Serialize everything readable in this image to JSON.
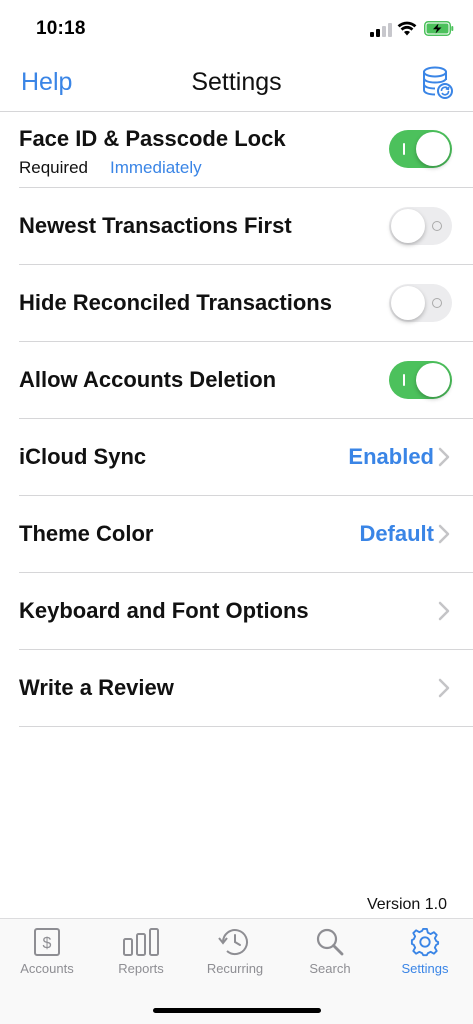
{
  "status_bar": {
    "time": "10:18",
    "icons": [
      "signal-icon",
      "wifi-icon",
      "battery-charging-icon"
    ]
  },
  "nav": {
    "left_button": "Help",
    "title": "Settings",
    "right_icon": "database-sync-icon"
  },
  "colors": {
    "accent": "#3a85e6",
    "toggle_on": "#4cc15c",
    "toggle_off": "#ececee"
  },
  "settings": {
    "face_id": {
      "label": "Face ID & Passcode Lock",
      "required_label": "Required",
      "required_value": "Immediately",
      "enabled": true
    },
    "newest_first": {
      "label": "Newest Transactions First",
      "enabled": false
    },
    "hide_reconciled": {
      "label": "Hide Reconciled Transactions",
      "enabled": false
    },
    "allow_deletion": {
      "label": "Allow Accounts Deletion",
      "enabled": true
    },
    "icloud_sync": {
      "label": "iCloud Sync",
      "value": "Enabled"
    },
    "theme_color": {
      "label": "Theme Color",
      "value": "Default"
    },
    "keyboard_font": {
      "label": "Keyboard and Font Options"
    },
    "write_review": {
      "label": "Write a Review"
    }
  },
  "version": "Version 1.0",
  "tabs": [
    {
      "label": "Accounts",
      "icon": "dollar-box-icon",
      "active": false
    },
    {
      "label": "Reports",
      "icon": "bar-chart-icon",
      "active": false
    },
    {
      "label": "Recurring",
      "icon": "recurring-clock-icon",
      "active": false
    },
    {
      "label": "Search",
      "icon": "magnifier-icon",
      "active": false
    },
    {
      "label": "Settings",
      "icon": "gear-icon",
      "active": true
    }
  ]
}
